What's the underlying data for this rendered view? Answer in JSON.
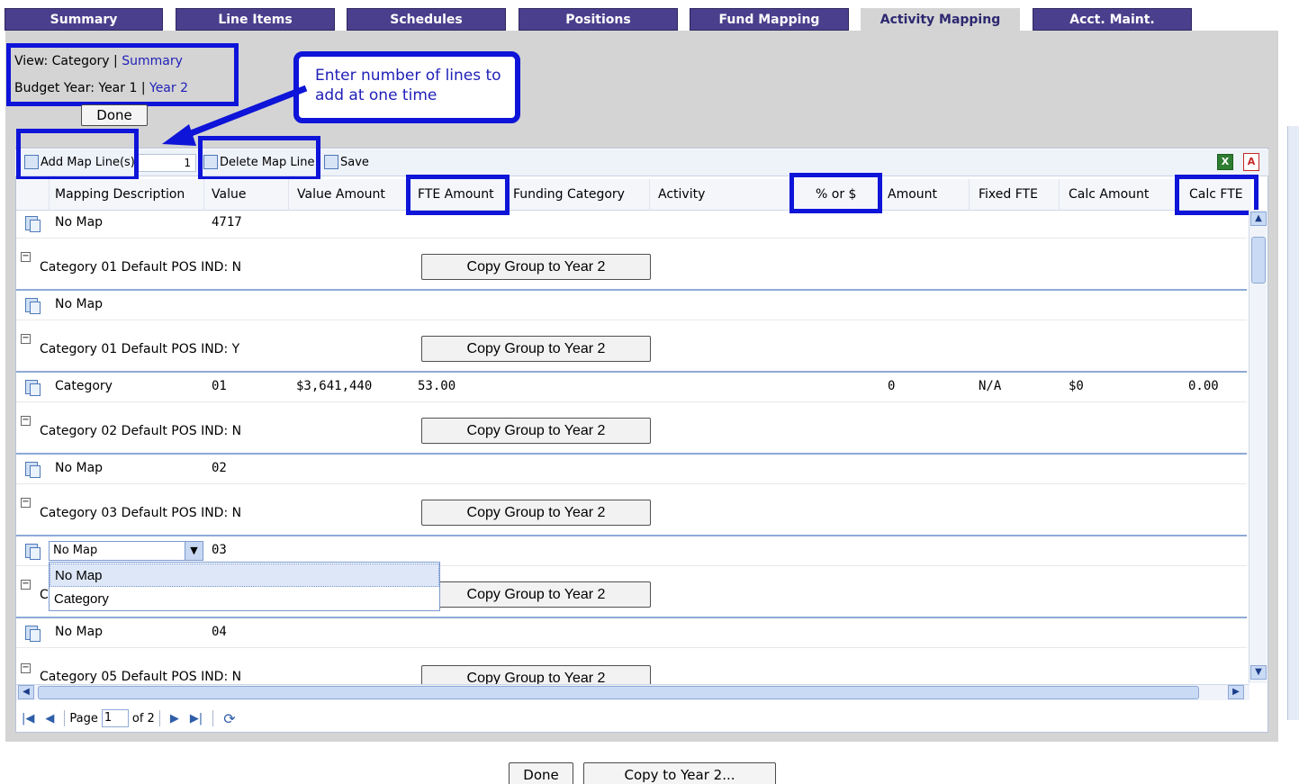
{
  "tabs": [
    "Summary",
    "Line Items",
    "Schedules",
    "Positions",
    "Fund Mapping",
    "Activity Mapping",
    "Acct. Maint."
  ],
  "view": {
    "label": "View:",
    "current": "Category",
    "sep": "|",
    "link": "Summary"
  },
  "budget_year": {
    "label": "Budget Year:",
    "current": "Year 1",
    "sep": "|",
    "link": "Year 2"
  },
  "done_label": "Done",
  "callout": "Enter number of lines to add at one time",
  "toolbar": {
    "add_label": "Add Map Line(s)",
    "lines_value": "1",
    "delete_label": "Delete Map Line",
    "save_label": "Save"
  },
  "columns": [
    "Mapping Description",
    "Value",
    "Value Amount",
    "FTE Amount",
    "Funding Category",
    "Activity",
    "% or $",
    "Amount",
    "Fixed FTE",
    "Calc Amount",
    "Calc FTE"
  ],
  "rows": [
    {
      "desc": "No Map",
      "value": "4717"
    },
    {
      "group": "Category 01 Default POS IND: N"
    },
    {
      "desc": "No Map"
    },
    {
      "group": "Category 01 Default POS IND: Y"
    },
    {
      "desc": "Category",
      "value": "01",
      "value_amount": "$3,641,440",
      "fte_amount": "53.00",
      "amount": "0",
      "fixed_fte": "N/A",
      "calc_amount": "$0",
      "calc_fte": "0.00"
    },
    {
      "group": "Category 02 Default POS IND: N"
    },
    {
      "desc": "No Map",
      "value": "02"
    },
    {
      "group": "Category 03 Default POS IND: N"
    },
    {
      "desc": "No Map",
      "value": "03"
    },
    {
      "group": "C"
    },
    {
      "desc": "No Map",
      "value": "04"
    },
    {
      "group": "Category 05 Default POS IND: N"
    }
  ],
  "copy_group_label": "Copy Group to Year 2",
  "dropdown": {
    "selected": "No Map",
    "options": [
      "No Map",
      "Category"
    ]
  },
  "pager": {
    "page_label": "Page",
    "page_value": "1",
    "of_label": "of 2"
  },
  "footer": {
    "done": "Done",
    "copy": "Copy to Year 2..."
  },
  "colors": {
    "tab": "#4a3f8c",
    "highlight": "#0e14d8",
    "panel": "#d4d4d4"
  }
}
